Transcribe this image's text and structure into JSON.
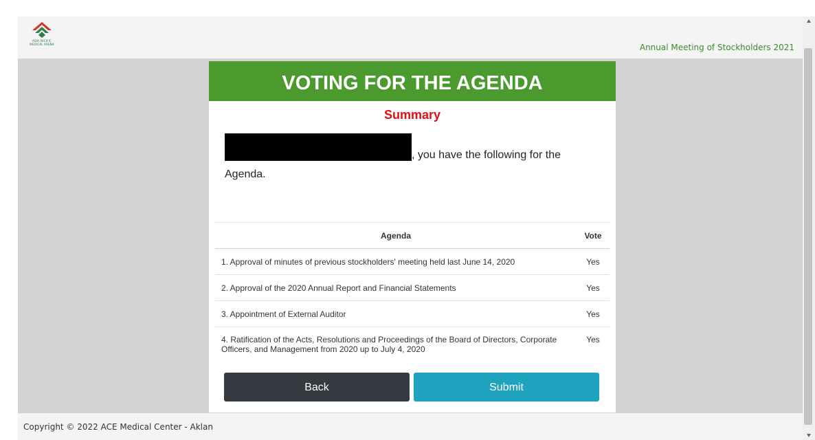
{
  "header": {
    "logo_line1": "ASIA PACIFIC",
    "logo_line2": "MEDICAL ARENA",
    "event_title": "Annual Meeting of Stockholders 2021"
  },
  "card": {
    "banner": "VOTING FOR THE AGENDA",
    "summary": "Summary",
    "greeting_suffix": ", you have the following for the Agenda."
  },
  "table": {
    "headers": {
      "agenda": "Agenda",
      "vote": "Vote"
    },
    "rows": [
      {
        "agenda": "1. Approval of minutes of previous stockholders' meeting held last June 14, 2020",
        "vote": "Yes"
      },
      {
        "agenda": "2. Approval of the 2020 Annual Report and Financial Statements",
        "vote": "Yes"
      },
      {
        "agenda": "3. Appointment of External Auditor",
        "vote": "Yes"
      },
      {
        "agenda": "4. Ratification of the Acts, Resolutions and Proceedings of the Board of Directors, Corporate Officers, and Management from 2020 up to July 4, 2020",
        "vote": "Yes"
      }
    ]
  },
  "buttons": {
    "back": "Back",
    "submit": "Submit"
  },
  "footer": {
    "copyright": "Copyright © 2022 ACE Medical Center - Aklan"
  },
  "colors": {
    "brand_green": "#4a9a2d",
    "summary_red": "#e01010",
    "submit_teal": "#1ea3bf",
    "back_dark": "#343a40"
  },
  "icons": {
    "logo": "chevron-diamond-logo-icon",
    "scroll_up": "arrow-up-icon",
    "scroll_down": "arrow-down-icon"
  }
}
